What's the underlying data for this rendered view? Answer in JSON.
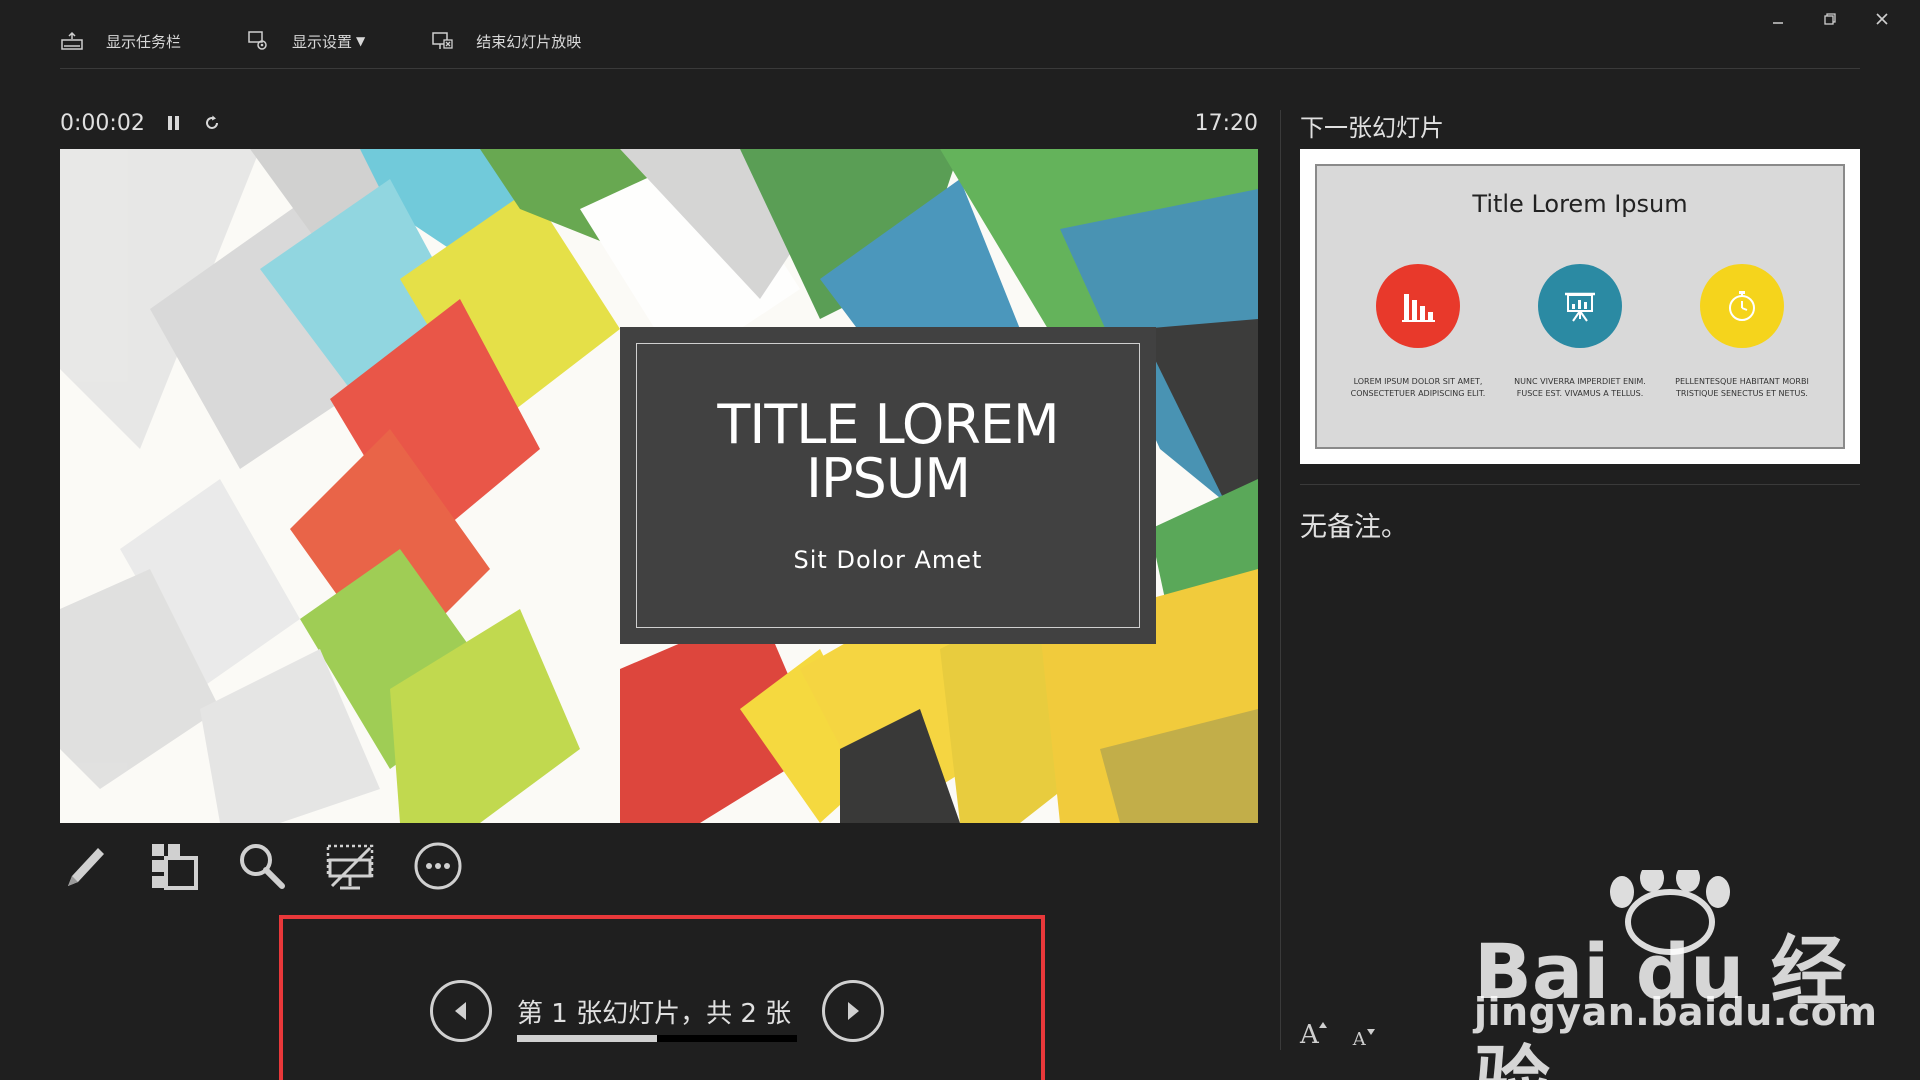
{
  "toolbar": {
    "show_taskbar": "显示任务栏",
    "display_settings": "显示设置",
    "display_settings_caret": "▼",
    "end_show": "结束幻灯片放映"
  },
  "timer": {
    "elapsed": "0:00:02",
    "clock": "17:20"
  },
  "current_slide": {
    "title": "TITLE LOREM IPSUM",
    "subtitle": "Sit Dolor Amet"
  },
  "navigation": {
    "counter": "第 1 张幻灯片，共 2 张",
    "current": 1,
    "total": 2
  },
  "next_slide": {
    "label": "下一张幻灯片",
    "title": "Title Lorem Ipsum",
    "items": [
      {
        "text": "LOREM IPSUM DOLOR SIT AMET, CONSECTETUER ADIPISCING ELIT.",
        "color": "#e8392b"
      },
      {
        "text": "NUNC VIVERRA IMPERDIET ENIM. FUSCE EST. VIVAMUS A TELLUS.",
        "color": "#2b8aa3"
      },
      {
        "text": "PELLENTESQUE HABITANT MORBI TRISTIQUE SENECTUS ET NETUS.",
        "color": "#f5d41c"
      }
    ]
  },
  "notes": {
    "text": "无备注。"
  },
  "font_buttons": {
    "increase": "A",
    "decrease": "A"
  },
  "watermark": {
    "brand": "Bai du 经验",
    "url": "jingyan.baidu.com"
  },
  "colors": {
    "background": "#1f1f1f",
    "highlight_frame": "#e8383a"
  }
}
